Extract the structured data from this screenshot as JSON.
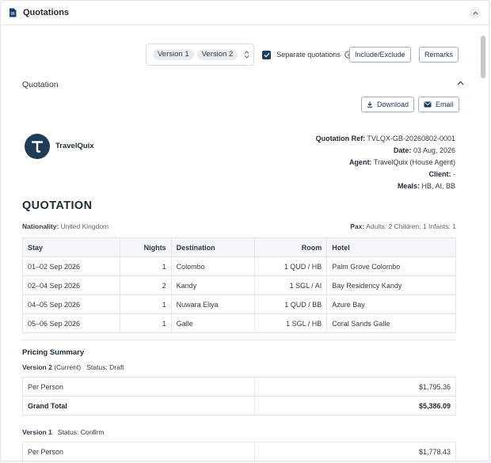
{
  "window": {
    "title": "Quotations",
    "collapse_icon": "chevron-up-icon"
  },
  "toolbar": {
    "versions": [
      "Version 1",
      "Version 2"
    ],
    "separate_label": "Separate quotations",
    "separate_checked": true,
    "include_exclude": "Include/Exclude",
    "remarks": "Remarks"
  },
  "section": {
    "title": "Quotation",
    "download": "Download",
    "email": "Email"
  },
  "agency": {
    "name": "TravelQuix",
    "logo_letter": "T",
    "logo_color": "#1f3b56"
  },
  "meta": [
    {
      "label": "Quotation Ref:",
      "value": "TVLQX-GB-20260802-0001"
    },
    {
      "label": "Date:",
      "value": "03 Aug, 2026"
    },
    {
      "label": "Agent:",
      "value": "TravelQuix (House Agent)"
    },
    {
      "label": "Client:",
      "value": "-"
    },
    {
      "label": "Meals:",
      "value": "HB, AI, BB"
    }
  ],
  "heading": "QUOTATION",
  "nationality": {
    "label": "Nationality:",
    "value": "United Kingdom"
  },
  "pax": {
    "label": "Pax:",
    "value": "Adults: 2 Children: 1 Infants: 1"
  },
  "stay_table": {
    "headers": [
      "Stay",
      "Nights",
      "Destination",
      "Room",
      "Hotel"
    ],
    "rows": [
      [
        "01–02 Sep 2026",
        "1",
        "Colombo",
        "1 QUD / HB",
        "Palm Grove Colombo"
      ],
      [
        "02–04 Sep 2026",
        "2",
        "Kandy",
        "1 SGL / AI",
        "Bay Residency Kandy"
      ],
      [
        "04–05 Sep 2026",
        "1",
        "Nuwara Eliya",
        "1 QUD / BB",
        "Azure Bay"
      ],
      [
        "05–06 Sep 2026",
        "1",
        "Galle",
        "1 SGL / HB",
        "Coral Sands Galle"
      ]
    ]
  },
  "pricing": {
    "title": "Pricing Summary",
    "versions": [
      {
        "name": "Version 2",
        "tag": "(Current)",
        "status": "Status: Draft",
        "rows": [
          [
            "Per Person",
            "$1,795.36"
          ],
          [
            "Grand Total",
            "$5,386.09"
          ]
        ]
      },
      {
        "name": "Version 1",
        "tag": "",
        "status": "Status: Confirm",
        "rows": [
          [
            "Per Person",
            "$1,778.43"
          ]
        ]
      }
    ]
  },
  "colors": {
    "accent": "#1e3a5f",
    "border": "#e3e6ea",
    "header_bg": "#f5f6f8"
  }
}
